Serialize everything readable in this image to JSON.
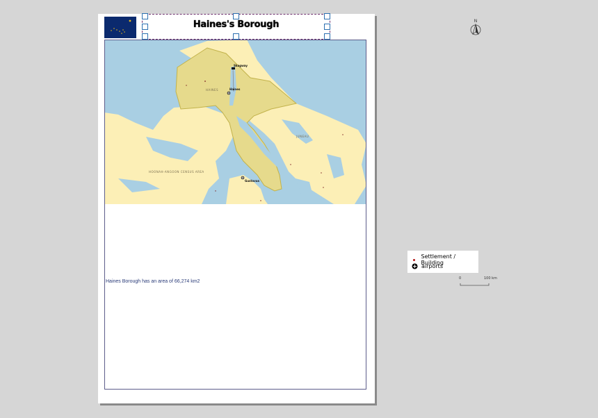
{
  "layout": {
    "title": "Haines's Borough",
    "area_text": "Haines Borough has an area of 66,274 km2"
  },
  "map": {
    "labels": {
      "skagway": "Skagway",
      "haines": "Haines",
      "haines_region": "HAINES",
      "juneau": "JUNEAU",
      "hoonah": "HOONAH-ANGOON CENSUS AREA",
      "gustavus": "Gustavus"
    },
    "colors": {
      "water": "#a9cfe3",
      "land": "#fcefb6",
      "borough": "#e6da8c",
      "borough_edge": "#c2b24a"
    }
  },
  "north_arrow": {
    "label": "N"
  },
  "legend": {
    "items": [
      {
        "label": "Settlement / Building",
        "icon": "red-dot-icon"
      },
      {
        "label": "airports",
        "icon": "airport-icon"
      }
    ]
  },
  "scalebar": {
    "start": "0",
    "end": "100 km"
  }
}
